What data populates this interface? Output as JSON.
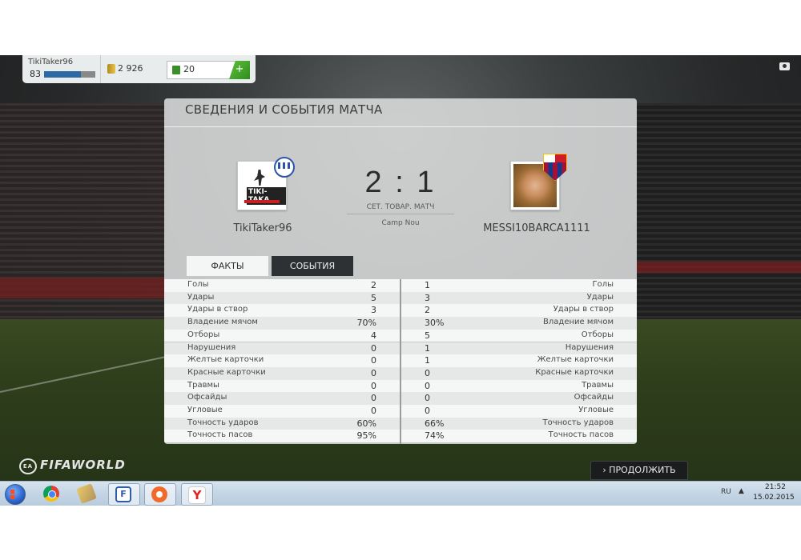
{
  "topbar": {
    "username": "TikiTaker96",
    "level": "83",
    "xp_progress": 0.72,
    "coins": "2 926",
    "points": "20",
    "add_label": "+"
  },
  "panel": {
    "title": "СВЕДЕНИЯ И СОБЫТИЯ МАТЧА",
    "home_team": "TikiTaker96",
    "home_logo_text": "TIKI-TAKA",
    "away_team": "MESSI10BARCA1111",
    "score": "2 : 1",
    "match_type": "СЕТ. ТОВАР. МАТЧ",
    "stadium": "Camp Nou",
    "tabs": [
      "ФАКТЫ",
      "СОБЫТИЯ"
    ],
    "stats": [
      {
        "label": "Голы",
        "home": "2",
        "away": "1"
      },
      {
        "label": "Удары",
        "home": "5",
        "away": "3"
      },
      {
        "label": "Удары в створ",
        "home": "3",
        "away": "2"
      },
      {
        "label": "Владение мячом",
        "home": "70%",
        "away": "30%"
      },
      {
        "label": "Отборы",
        "home": "4",
        "away": "5"
      },
      {
        "label": "Нарушения",
        "home": "0",
        "away": "1"
      },
      {
        "label": "Желтые карточки",
        "home": "0",
        "away": "1"
      },
      {
        "label": "Красные карточки",
        "home": "0",
        "away": "0"
      },
      {
        "label": "Травмы",
        "home": "0",
        "away": "0"
      },
      {
        "label": "Офсайды",
        "home": "0",
        "away": "0"
      },
      {
        "label": "Угловые",
        "home": "0",
        "away": "0"
      },
      {
        "label": "Точность ударов",
        "home": "60%",
        "away": "66%"
      },
      {
        "label": "Точность пасов",
        "home": "95%",
        "away": "74%"
      }
    ]
  },
  "footer": {
    "logo_ea": "EA",
    "logo_text": "FIFAWORLD",
    "continue_label": "› ПРОДОЛЖИТЬ"
  },
  "taskbar": {
    "fifa_icon_letter": "F",
    "yandex_icon_letter": "Y",
    "lang": "RU",
    "tray_arrow": "▲",
    "time": "21:52",
    "date": "15.02.2015"
  }
}
